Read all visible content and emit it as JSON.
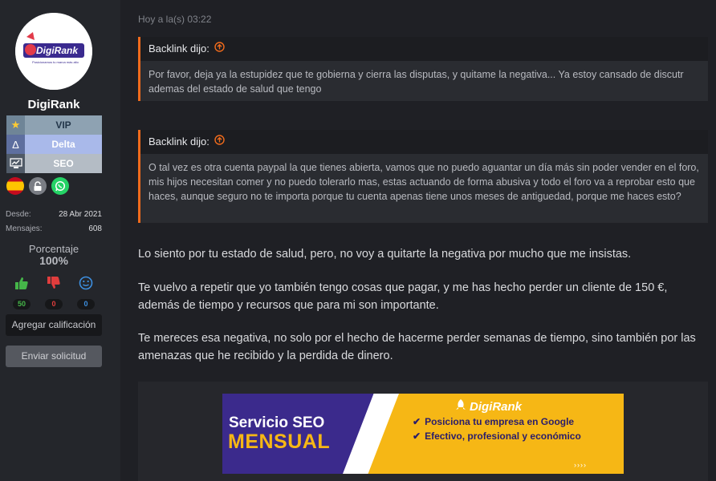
{
  "user": {
    "avatar_brand": "DigiRank",
    "avatar_tagline": "Posicionamos tu marca más alto",
    "name": "DigiRank",
    "banners": [
      {
        "label": "VIP",
        "icon": "star-icon"
      },
      {
        "label": "Delta",
        "icon": "delta-icon"
      },
      {
        "label": "SEO",
        "icon": "seo-icon"
      }
    ],
    "badges": [
      "spain-flag-icon",
      "lock-icon",
      "whatsapp-icon"
    ],
    "since_label": "Desde:",
    "since_value": "28 Abr 2021",
    "messages_label": "Mensajes:",
    "messages_value": "608",
    "percent_label": "Porcentaje",
    "percent_value": "100%",
    "ratings": {
      "positive": "50",
      "negative": "0",
      "neutral": "0"
    },
    "rate_button": "Agregar calificación",
    "request_button": "Enviar solicitud"
  },
  "post": {
    "timestamp": "Hoy a la(s) 03:22",
    "quotes": [
      {
        "author": "Backlink dijo:",
        "text": "Por favor, deja ya la estupidez que te gobierna y cierra las disputas, y quitame la negativa... Ya estoy cansado de discutr ademas del estado de salud que tengo"
      },
      {
        "author": "Backlink dijo:",
        "text": "O tal vez es otra cuenta paypal la que tienes abierta, vamos que no puedo aguantar un día más sin poder vender en el foro, mis hijos necesitan comer y no puedo tolerarlo mas, estas actuando de forma abusiva y todo el foro va a reprobar esto que haces, aunque seguro no te importa porque tu cuenta apenas tiene unos meses de antiguedad, porque me haces esto?"
      }
    ],
    "paragraphs": [
      "Lo siento por tu estado de salud, pero, no voy a quitarte la negativa por mucho que me insistas.",
      "Te vuelvo a repetir que yo también tengo cosas que pagar, y me has hecho perder un cliente de 150 €, además de tiempo y recursos que para mi son importante.",
      "Te mereces esa negativa, no solo por el hecho de hacerme perder semanas de tiempo, sino también por las amenazas que he recibido y la perdida de dinero."
    ]
  },
  "ad": {
    "line1": "Servicio SEO",
    "line2": "MENSUAL",
    "brand": "DigiRank",
    "bullets": [
      "Posiciona tu empresa en Google",
      "Efectivo, profesional y económico"
    ],
    "arrows": "››››"
  },
  "colors": {
    "accent": "#f06b1c",
    "background": "#1f2025",
    "sidebar": "#24262b",
    "ad_yellow": "#f6b715",
    "ad_purple": "#3b2a8c"
  }
}
